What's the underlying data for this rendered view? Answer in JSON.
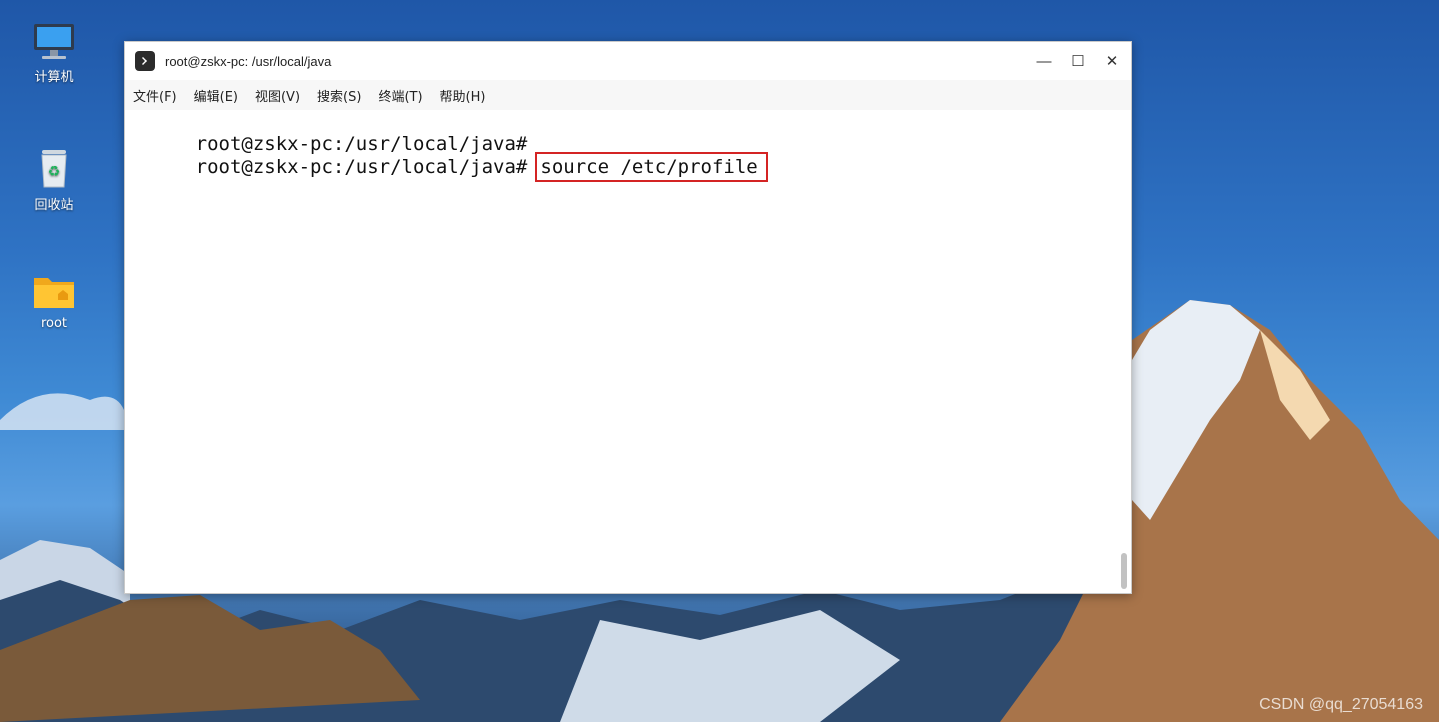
{
  "desktop": {
    "icons": [
      {
        "label": "计算机",
        "icon": "computer-icon"
      },
      {
        "label": "回收站",
        "icon": "trash-icon"
      },
      {
        "label": "root",
        "icon": "folder-icon"
      }
    ]
  },
  "window": {
    "title": "root@zskx-pc: /usr/local/java",
    "controls": {
      "minimize": "—",
      "maximize": "☐",
      "close": "✕"
    },
    "menu": [
      "文件(F)",
      "编辑(E)",
      "视图(V)",
      "搜索(S)",
      "终端(T)",
      "帮助(H)"
    ],
    "terminal": {
      "lines": [
        {
          "prompt": "root@zskx-pc:/usr/local/java#",
          "command": ""
        },
        {
          "prompt": "root@zskx-pc:/usr/local/java#",
          "command": "source /etc/profile"
        }
      ]
    }
  },
  "watermark": "CSDN @qq_27054163",
  "colors": {
    "highlight_border": "#d42424"
  }
}
